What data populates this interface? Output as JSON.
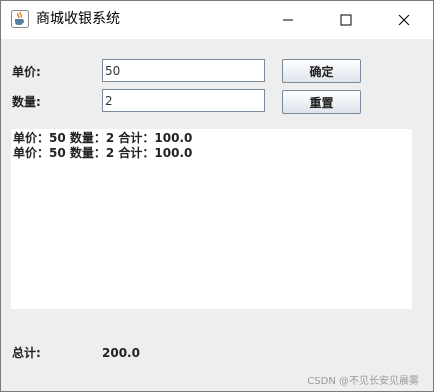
{
  "window": {
    "title": "商城收银系统",
    "icon": "java-cup-icon"
  },
  "form": {
    "price_label": "单价:",
    "price_value": "50",
    "quantity_label": "数量:",
    "quantity_value": "2",
    "confirm_label": "确定",
    "reset_label": "重置"
  },
  "output": {
    "lines": [
      "单价：50 数量：2 合计：100.0",
      "单价：50 数量：2 合计：100.0"
    ]
  },
  "footer": {
    "total_label": "总计:",
    "total_value": "200.0"
  },
  "watermark": "CSDN @不见长安见晨雾"
}
